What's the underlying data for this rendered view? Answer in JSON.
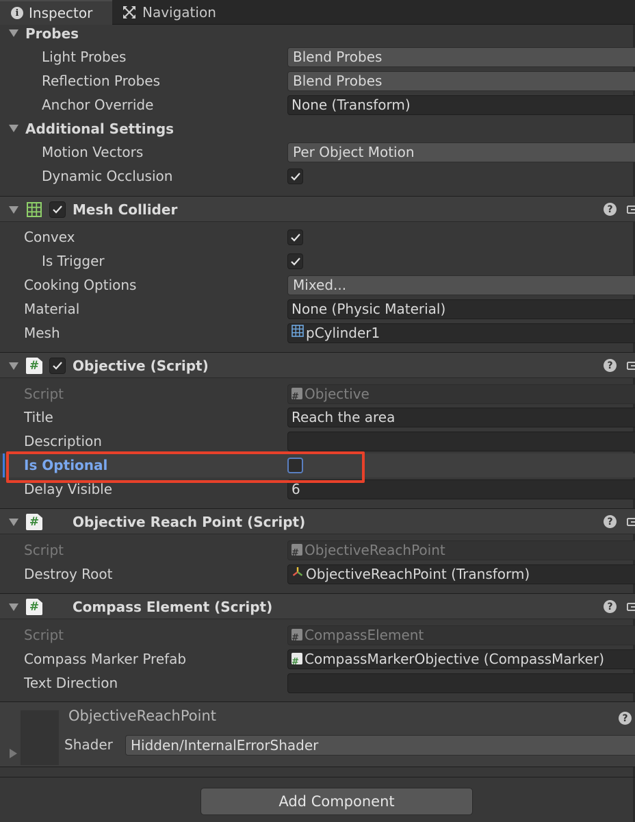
{
  "tabs": [
    {
      "label": "Inspector",
      "icon": "info-icon"
    },
    {
      "label": "Navigation",
      "icon": "navigation-icon"
    }
  ],
  "renderer": {
    "probes_label": "Probes",
    "light_probes_label": "Light Probes",
    "light_probes_value": "Blend Probes",
    "reflection_probes_label": "Reflection Probes",
    "reflection_probes_value": "Blend Probes",
    "anchor_override_label": "Anchor Override",
    "anchor_override_value": "None (Transform)",
    "additional_settings_label": "Additional Settings",
    "motion_vectors_label": "Motion Vectors",
    "motion_vectors_value": "Per Object Motion",
    "dynamic_occlusion_label": "Dynamic Occlusion",
    "dynamic_occlusion_checked": true
  },
  "mesh_collider": {
    "title": "Mesh Collider",
    "enabled": true,
    "convex_label": "Convex",
    "convex_checked": true,
    "is_trigger_label": "Is Trigger",
    "is_trigger_checked": true,
    "cooking_options_label": "Cooking Options",
    "cooking_options_value": "Mixed...",
    "material_label": "Material",
    "material_value": "None (Physic Material)",
    "mesh_label": "Mesh",
    "mesh_value": "pCylinder1"
  },
  "objective": {
    "title": "Objective (Script)",
    "enabled": true,
    "script_label": "Script",
    "script_value": "Objective",
    "title_label": "Title",
    "title_value": "Reach the area",
    "description_label": "Description",
    "description_value": "",
    "is_optional_label": "Is Optional",
    "is_optional_checked": false,
    "delay_visible_label": "Delay Visible",
    "delay_visible_value": "6"
  },
  "objective_reach_point": {
    "title": "Objective Reach Point (Script)",
    "script_label": "Script",
    "script_value": "ObjectiveReachPoint",
    "destroy_root_label": "Destroy Root",
    "destroy_root_value": "ObjectiveReachPoint (Transform)"
  },
  "compass_element": {
    "title": "Compass Element (Script)",
    "script_label": "Script",
    "script_value": "CompassElement",
    "compass_marker_prefab_label": "Compass Marker Prefab",
    "compass_marker_prefab_value": "CompassMarkerObjective (CompassMarker)",
    "text_direction_label": "Text Direction",
    "text_direction_value": ""
  },
  "material": {
    "name": "ObjectiveReachPoint",
    "shader_label": "Shader",
    "shader_value": "Hidden/InternalErrorShader"
  },
  "add_component_label": "Add Component",
  "colors": {
    "highlight_box": "#e8412a",
    "selected_label": "#7aa8f0",
    "script_icon_green": "#3c8a3c"
  }
}
